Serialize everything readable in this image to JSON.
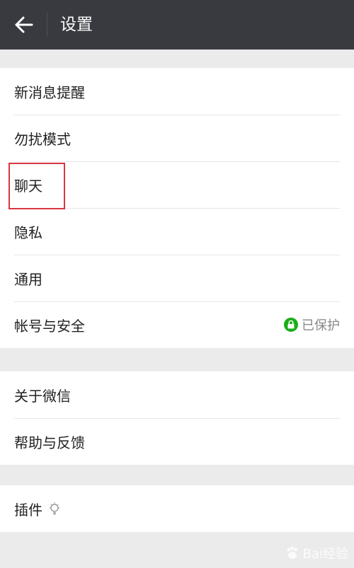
{
  "topbar": {
    "title": "设置",
    "back_icon": "arrow-left-icon",
    "background": "#393a3f"
  },
  "groups": [
    {
      "items": [
        {
          "label": "新消息提醒"
        },
        {
          "label": "勿扰模式"
        },
        {
          "label": "聊天",
          "highlighted": true
        },
        {
          "label": "隐私"
        },
        {
          "label": "通用"
        },
        {
          "label": "帐号与安全",
          "status": "已保护",
          "status_icon": "lock-icon",
          "status_color": "#1aad19"
        }
      ]
    },
    {
      "items": [
        {
          "label": "关于微信"
        },
        {
          "label": "帮助与反馈"
        }
      ]
    },
    {
      "items": [
        {
          "label": "插件",
          "icon": "lightbulb-icon"
        }
      ]
    }
  ],
  "highlight_color": "#d9363e",
  "watermark": {
    "text": "Bai经验"
  }
}
